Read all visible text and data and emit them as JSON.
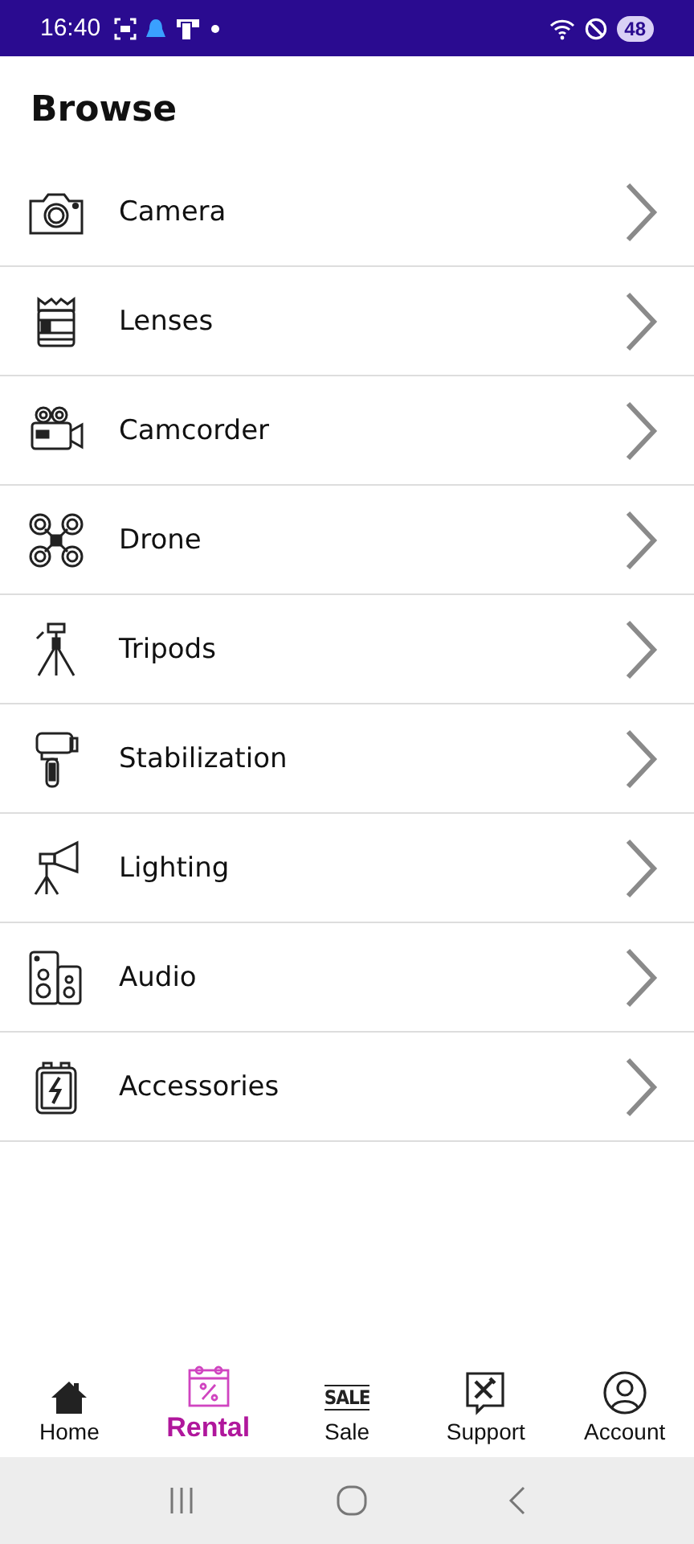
{
  "status_bar": {
    "time": "16:40",
    "battery": "48"
  },
  "header": {
    "title": "Browse"
  },
  "categories": [
    {
      "kind": "camera",
      "label": "Camera"
    },
    {
      "kind": "lens",
      "label": "Lenses"
    },
    {
      "kind": "camcorder",
      "label": "Camcorder"
    },
    {
      "kind": "drone",
      "label": "Drone"
    },
    {
      "kind": "tripod",
      "label": "Tripods"
    },
    {
      "kind": "gimbal",
      "label": "Stabilization"
    },
    {
      "kind": "light",
      "label": "Lighting"
    },
    {
      "kind": "speaker",
      "label": "Audio"
    },
    {
      "kind": "battery",
      "label": "Accessories"
    }
  ],
  "bottom_nav": [
    {
      "kind": "home",
      "label": "Home",
      "selected": false
    },
    {
      "kind": "rental",
      "label": "Rental",
      "selected": true
    },
    {
      "kind": "sale",
      "label": "Sale",
      "icon_text": "SALE",
      "selected": false
    },
    {
      "kind": "support",
      "label": "Support",
      "selected": false
    },
    {
      "kind": "account",
      "label": "Account",
      "selected": false
    }
  ]
}
